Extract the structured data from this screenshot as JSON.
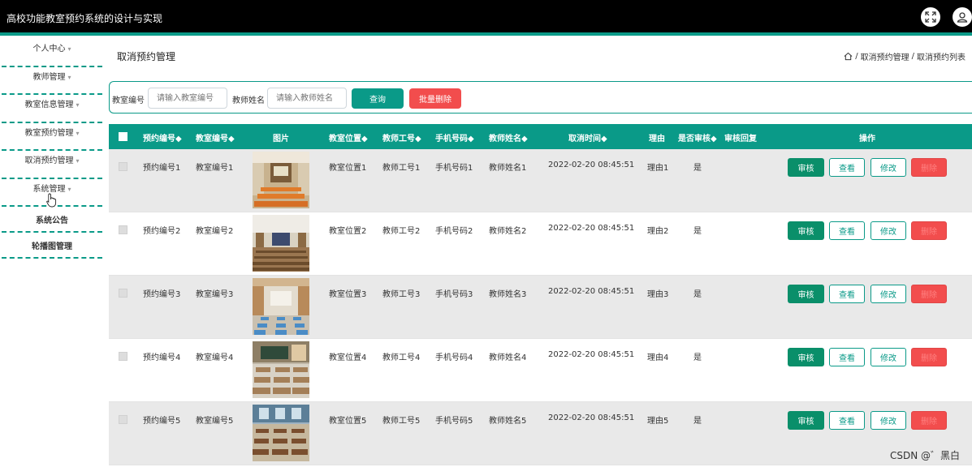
{
  "app": {
    "title": "高校功能教室预约系统的设计与实现"
  },
  "sidebar": {
    "items": [
      {
        "label": "个人中心",
        "caret": "▾"
      },
      {
        "label": "教师管理",
        "caret": "▾"
      },
      {
        "label": "教室信息管理",
        "caret": "▾"
      },
      {
        "label": "教室预约管理",
        "caret": "▾"
      },
      {
        "label": "取消预约管理",
        "caret": "▾"
      },
      {
        "label": "系统管理",
        "caret": "▾"
      },
      {
        "label": "系统公告"
      },
      {
        "label": "轮播图管理"
      }
    ]
  },
  "page": {
    "title": "取消预约管理"
  },
  "breadcrumb": {
    "sep": "/",
    "item1": "取消预约管理",
    "item2": "取消预约列表"
  },
  "search": {
    "classroom_label": "教室编号",
    "classroom_placeholder": "请输入教室编号",
    "teacher_label": "教师姓名",
    "teacher_placeholder": "请输入教师姓名",
    "query_label": "查询",
    "batch_delete_label": "批量删除"
  },
  "table": {
    "headers": [
      "预约编号◆",
      "教室编号◆",
      "图片",
      "教室位置◆",
      "教师工号◆",
      "手机号码◆",
      "教师姓名◆",
      "取消时间◆",
      "理由",
      "是否审核◆",
      "审核回复",
      "操作"
    ],
    "rows": [
      {
        "booking_no": "预约编号1",
        "room_no": "教室编号1",
        "location": "教室位置1",
        "teacher_id": "教师工号1",
        "phone": "手机号码1",
        "teacher_name": "教师姓名1",
        "cancel_time": "2022-02-20 08:45:51",
        "reason": "理由1",
        "reviewed": "是",
        "reply": ""
      },
      {
        "booking_no": "预约编号2",
        "room_no": "教室编号2",
        "location": "教室位置2",
        "teacher_id": "教师工号2",
        "phone": "手机号码2",
        "teacher_name": "教师姓名2",
        "cancel_time": "2022-02-20 08:45:51",
        "reason": "理由2",
        "reviewed": "是",
        "reply": ""
      },
      {
        "booking_no": "预约编号3",
        "room_no": "教室编号3",
        "location": "教室位置3",
        "teacher_id": "教师工号3",
        "phone": "手机号码3",
        "teacher_name": "教师姓名3",
        "cancel_time": "2022-02-20 08:45:51",
        "reason": "理由3",
        "reviewed": "是",
        "reply": ""
      },
      {
        "booking_no": "预约编号4",
        "room_no": "教室编号4",
        "location": "教室位置4",
        "teacher_id": "教师工号4",
        "phone": "手机号码4",
        "teacher_name": "教师姓名4",
        "cancel_time": "2022-02-20 08:45:51",
        "reason": "理由4",
        "reviewed": "是",
        "reply": ""
      },
      {
        "booking_no": "预约编号5",
        "room_no": "教室编号5",
        "location": "教室位置5",
        "teacher_id": "教师工号5",
        "phone": "手机号码5",
        "teacher_name": "教师姓名5",
        "cancel_time": "2022-02-20 08:45:51",
        "reason": "理由5",
        "reviewed": "是",
        "reply": ""
      }
    ],
    "actions": {
      "audit": "审核",
      "view": "查看",
      "edit": "修改",
      "delete": "删除"
    }
  },
  "watermark": "CSDN @゛黑白",
  "colors": {
    "primary": "#0a9a88",
    "danger": "#f24d4d",
    "audit": "#0a8f6a",
    "topbar": "#000000"
  },
  "icons": {
    "fullscreen": "fullscreen-icon",
    "user": "user-icon",
    "home": "home-icon"
  }
}
